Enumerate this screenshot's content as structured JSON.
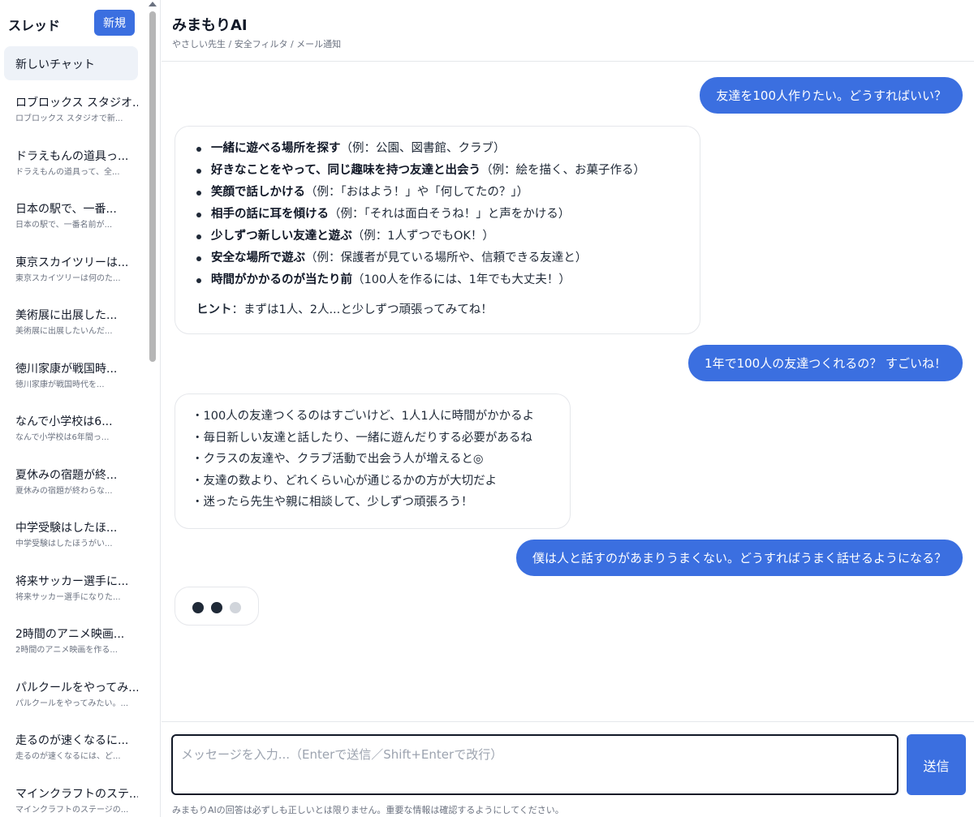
{
  "sidebar": {
    "title": "スレッド",
    "new_button": "新規",
    "active_thread": "新しいチャット",
    "threads": [
      {
        "title": "ロブロックス スタジオ...",
        "preview": "ロブロックス スタジオで新..."
      },
      {
        "title": "ドラえもんの道具っ...",
        "preview": "ドラえもんの道具って、全..."
      },
      {
        "title": "日本の駅で、一番...",
        "preview": "日本の駅で、一番名前が..."
      },
      {
        "title": "東京スカイツリーは...",
        "preview": "東京スカイツリーは何のた..."
      },
      {
        "title": "美術展に出展した...",
        "preview": "美術展に出展したいんだ..."
      },
      {
        "title": "徳川家康が戦国時...",
        "preview": "徳川家康が戦国時代を..."
      },
      {
        "title": "なんで小学校は6...",
        "preview": "なんで小学校は6年間っ..."
      },
      {
        "title": "夏休みの宿題が終...",
        "preview": "夏休みの宿題が終わらな..."
      },
      {
        "title": "中学受験はしたほ...",
        "preview": "中学受験はしたほうがい..."
      },
      {
        "title": "将来サッカー選手に...",
        "preview": "将来サッカー選手になりた..."
      },
      {
        "title": "2時間のアニメ映画...",
        "preview": "2時間のアニメ映画を作る..."
      },
      {
        "title": "パルクールをやってみ...",
        "preview": "パルクールをやってみたい。..."
      },
      {
        "title": "走るのが速くなるに...",
        "preview": "走るのが速くなるには、ど..."
      },
      {
        "title": "マインクラフトのステ...",
        "preview": "マインクラフトのステージの..."
      }
    ]
  },
  "header": {
    "title": "みまもりAI",
    "subtitle": "やさしい先生 / 安全フィルタ / メール通知"
  },
  "messages": {
    "user1": "友達を100人作りたい。どうすればいい？",
    "ai1": {
      "items": [
        {
          "bold": "一緒に遊べる場所を探す",
          "rest": "（例：公園、図書館、クラブ）"
        },
        {
          "bold": "好きなことをやって、同じ趣味を持つ友達と出会う",
          "rest": "（例：絵を描く、お菓子作る）"
        },
        {
          "bold": "笑顔で話しかける",
          "rest": "（例：「おはよう！」や「何してたの？」）"
        },
        {
          "bold": "相手の話に耳を傾ける",
          "rest": "（例：「それは面白そうね！」と声をかける）"
        },
        {
          "bold": "少しずつ新しい友達と遊ぶ",
          "rest": "（例：1人ずつでもOK！）"
        },
        {
          "bold": "安全な場所で遊ぶ",
          "rest": "（例：保護者が見ている場所や、信頼できる友達と）"
        },
        {
          "bold": "時間がかかるのが当たり前",
          "rest": "（100人を作るには、1年でも大丈夫！）"
        }
      ],
      "hint_label": "ヒント",
      "hint_text": "：まずは1人、2人...と少しずつ頑張ってみてね！"
    },
    "user2": "1年で100人の友達つくれるの？ すごいね！",
    "ai2": [
      "・100人の友達つくるのはすごいけど、1人1人に時間がかかるよ",
      "・毎日新しい友達と話したり、一緒に遊んだりする必要があるね",
      "・クラスの友達や、クラブ活動で出会う人が増えると◎",
      "・友達の数より、どれくらい心が通じるかの方が大切だよ",
      "・迷ったら先生や親に相談して、少しずつ頑張ろう！"
    ],
    "user3": "僕は人と話すのがあまりうまくない。どうすればうまく話せるようになる？"
  },
  "composer": {
    "placeholder": "メッセージを入力...（Enterで送信／Shift+Enterで改行）",
    "send_label": "送信",
    "disclaimer": "みまもりAIの回答は必ずしも正しいとは限りません。重要な情報は確認するようにしてください。"
  },
  "colors": {
    "accent": "#3b6fe0",
    "typing_dot_active": "#1f2937",
    "typing_dot_inactive": "#d1d5db"
  }
}
